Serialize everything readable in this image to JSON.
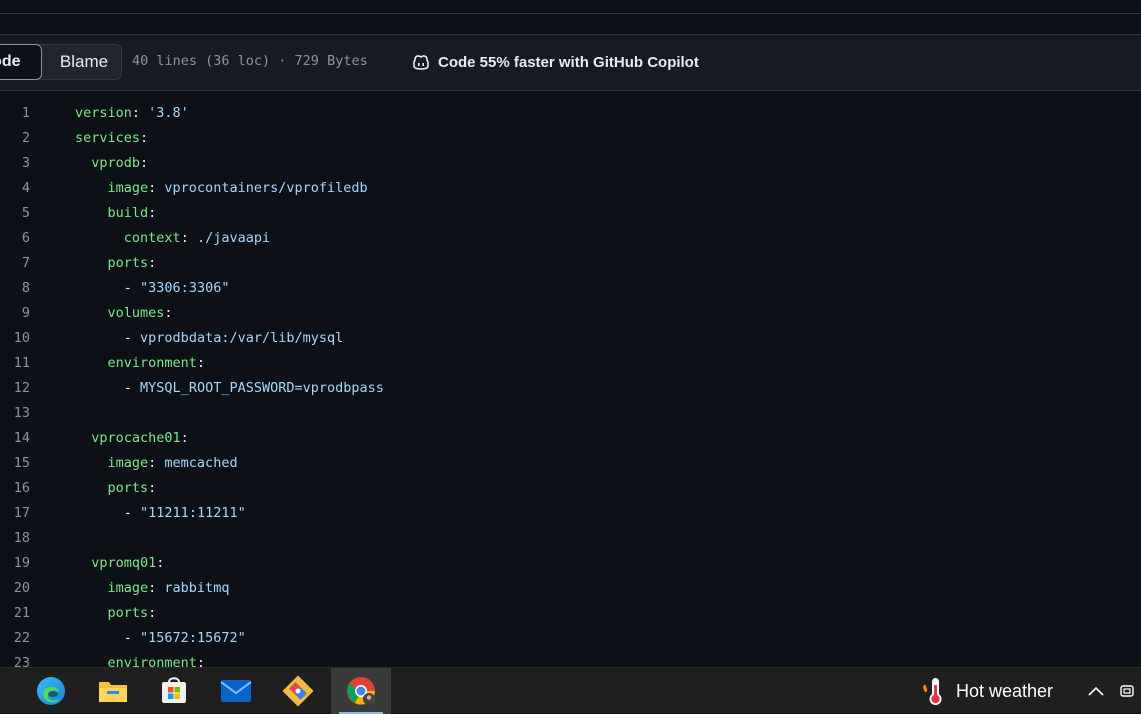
{
  "toolbar": {
    "code_label": "Code",
    "blame_label": "Blame",
    "file_info": "40 lines (36 loc) · 729 Bytes",
    "copilot_text": "Code 55% faster with GitHub Copilot",
    "copilot_icon": "copilot-icon"
  },
  "code_lines": [
    {
      "n": "1",
      "indent": "",
      "key": "version",
      "rest": ": ",
      "val": "'3.8'"
    },
    {
      "n": "2",
      "indent": "",
      "key": "services",
      "rest": ":",
      "val": ""
    },
    {
      "n": "3",
      "indent": "  ",
      "key": "vprodb",
      "rest": ":",
      "val": ""
    },
    {
      "n": "4",
      "indent": "    ",
      "key": "image",
      "rest": ": ",
      "val": "vprocontainers/vprofiledb"
    },
    {
      "n": "5",
      "indent": "    ",
      "key": "build",
      "rest": ":",
      "val": ""
    },
    {
      "n": "6",
      "indent": "      ",
      "key": "context",
      "rest": ": ",
      "val": "./javaapi"
    },
    {
      "n": "7",
      "indent": "    ",
      "key": "ports",
      "rest": ":",
      "val": ""
    },
    {
      "n": "8",
      "indent": "      ",
      "key": "",
      "rest": "- ",
      "val": "\"3306:3306\""
    },
    {
      "n": "9",
      "indent": "    ",
      "key": "volumes",
      "rest": ":",
      "val": ""
    },
    {
      "n": "10",
      "indent": "      ",
      "key": "",
      "rest": "- ",
      "val": "vprodbdata:/var/lib/mysql"
    },
    {
      "n": "11",
      "indent": "    ",
      "key": "environment",
      "rest": ":",
      "val": ""
    },
    {
      "n": "12",
      "indent": "      ",
      "key": "",
      "rest": "- ",
      "val": "MYSQL_ROOT_PASSWORD=vprodbpass"
    },
    {
      "n": "13",
      "indent": "",
      "key": "",
      "rest": "",
      "val": ""
    },
    {
      "n": "14",
      "indent": "  ",
      "key": "vprocache01",
      "rest": ":",
      "val": ""
    },
    {
      "n": "15",
      "indent": "    ",
      "key": "image",
      "rest": ": ",
      "val": "memcached"
    },
    {
      "n": "16",
      "indent": "    ",
      "key": "ports",
      "rest": ":",
      "val": ""
    },
    {
      "n": "17",
      "indent": "      ",
      "key": "",
      "rest": "- ",
      "val": "\"11211:11211\""
    },
    {
      "n": "18",
      "indent": "",
      "key": "",
      "rest": "",
      "val": ""
    },
    {
      "n": "19",
      "indent": "  ",
      "key": "vpromq01",
      "rest": ":",
      "val": ""
    },
    {
      "n": "20",
      "indent": "    ",
      "key": "image",
      "rest": ": ",
      "val": "rabbitmq"
    },
    {
      "n": "21",
      "indent": "    ",
      "key": "ports",
      "rest": ":",
      "val": ""
    },
    {
      "n": "22",
      "indent": "      ",
      "key": "",
      "rest": "- ",
      "val": "\"15672:15672\""
    },
    {
      "n": "23",
      "indent": "    ",
      "key": "environment",
      "rest": ":",
      "val": ""
    }
  ],
  "taskbar": {
    "apps": [
      {
        "name": "edge-icon",
        "active": false
      },
      {
        "name": "file-explorer-icon",
        "active": false
      },
      {
        "name": "microsoft-store-icon",
        "active": false
      },
      {
        "name": "mail-icon",
        "active": false
      },
      {
        "name": "git-client-icon",
        "active": false
      },
      {
        "name": "chrome-icon",
        "active": true
      }
    ],
    "weather_text": "Hot weather",
    "weather_icon": "thermometer-icon"
  },
  "colors": {
    "background": "#0d1117",
    "toolbar": "#161b22",
    "key": "#7ee787",
    "value": "#a5d6ff",
    "line_number": "#8b949e"
  }
}
